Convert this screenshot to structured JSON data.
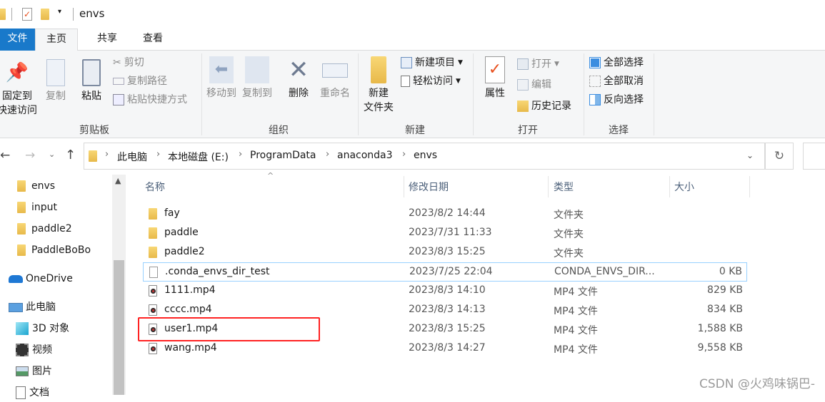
{
  "window": {
    "title": "envs"
  },
  "tabs": [
    {
      "label": "文件"
    },
    {
      "label": "主页"
    },
    {
      "label": "共享"
    },
    {
      "label": "查看"
    }
  ],
  "ribbon": {
    "clipboard": {
      "label": "剪贴板",
      "pin": "固定到\n快速访问",
      "pin1": "固定到",
      "pin2": "快速访问",
      "copy": "复制",
      "paste": "粘贴",
      "cut": "剪切",
      "copy_path": "复制路径",
      "paste_shortcut": "粘贴快捷方式"
    },
    "organize": {
      "label": "组织",
      "move_to": "移动到",
      "copy_to": "复制到",
      "delete": "删除",
      "rename": "重命名"
    },
    "new": {
      "label": "新建",
      "new_folder1": "新建",
      "new_folder2": "文件夹",
      "new_item": "新建项目",
      "easy_access": "轻松访问"
    },
    "open": {
      "label": "打开",
      "properties": "属性",
      "open": "打开",
      "edit": "编辑",
      "history": "历史记录"
    },
    "select": {
      "label": "选择",
      "select_all": "全部选择",
      "select_none": "全部取消",
      "invert": "反向选择"
    }
  },
  "address": {
    "crumbs": [
      "此电脑",
      "本地磁盘 (E:)",
      "ProgramData",
      "anaconda3",
      "envs"
    ]
  },
  "nav": {
    "items": [
      {
        "label": "envs",
        "icon": "folder-icon"
      },
      {
        "label": "input",
        "icon": "folder-icon"
      },
      {
        "label": "paddle2",
        "icon": "folder-icon"
      },
      {
        "label": "PaddleBoBo",
        "icon": "folder-icon"
      },
      {
        "label": "OneDrive",
        "icon": "onedrive-icon"
      },
      {
        "label": "此电脑",
        "icon": "computer-icon"
      },
      {
        "label": "3D 对象",
        "icon": "3d-objects-icon"
      },
      {
        "label": "视频",
        "icon": "video-icon"
      },
      {
        "label": "图片",
        "icon": "pictures-icon"
      },
      {
        "label": "文档",
        "icon": "documents-icon"
      }
    ]
  },
  "columns": {
    "name": "名称",
    "date": "修改日期",
    "type": "类型",
    "size": "大小"
  },
  "files": [
    {
      "name": "fay",
      "date": "2023/8/2 14:44",
      "type": "文件夹",
      "size": "",
      "kind": "folder"
    },
    {
      "name": "paddle",
      "date": "2023/7/31 11:33",
      "type": "文件夹",
      "size": "",
      "kind": "folder"
    },
    {
      "name": "paddle2",
      "date": "2023/8/3 15:25",
      "type": "文件夹",
      "size": "",
      "kind": "folder"
    },
    {
      "name": ".conda_envs_dir_test",
      "date": "2023/7/25 22:04",
      "type": "CONDA_ENVS_DIR...",
      "size": "0 KB",
      "kind": "file"
    },
    {
      "name": "1111.mp4",
      "date": "2023/8/3 14:10",
      "type": "MP4 文件",
      "size": "829 KB",
      "kind": "mp4"
    },
    {
      "name": "cccc.mp4",
      "date": "2023/8/3 14:13",
      "type": "MP4 文件",
      "size": "834 KB",
      "kind": "mp4"
    },
    {
      "name": "user1.mp4",
      "date": "2023/8/3 15:25",
      "type": "MP4 文件",
      "size": "1,588 KB",
      "kind": "mp4"
    },
    {
      "name": "wang.mp4",
      "date": "2023/8/3 14:27",
      "type": "MP4 文件",
      "size": "9,558 KB",
      "kind": "mp4"
    }
  ],
  "watermark": "CSDN @火鸡味锅巴-",
  "colors": {
    "accent": "#1979ca",
    "highlight": "#ff2222",
    "selection_border": "#99d1ff"
  }
}
